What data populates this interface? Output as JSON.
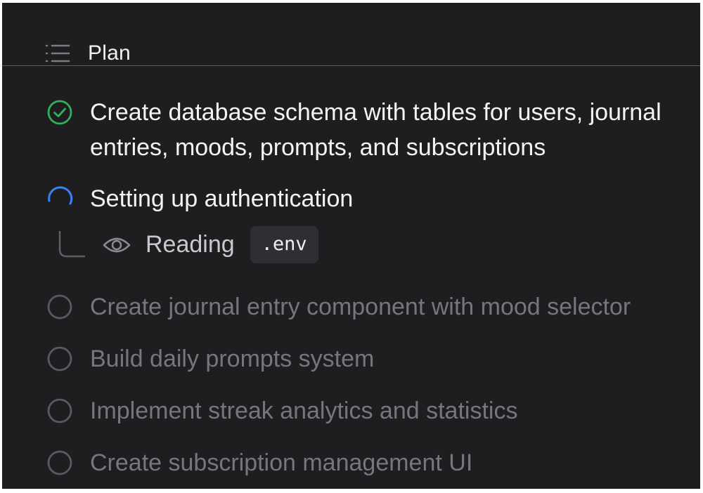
{
  "header": {
    "title": "Plan",
    "icon": "list-icon"
  },
  "tasks": [
    {
      "label": "Create database schema with tables for users, journal entries, moods, prompts, and subscriptions",
      "status": "done",
      "icon": "check-circle-icon"
    },
    {
      "label": "Setting up authentication",
      "status": "in-progress",
      "icon": "spinner-icon"
    },
    {
      "label": "Create journal entry component with mood selector",
      "status": "pending",
      "icon": "empty-circle-icon"
    },
    {
      "label": "Build daily prompts system",
      "status": "pending",
      "icon": "empty-circle-icon"
    },
    {
      "label": "Implement streak analytics and statistics",
      "status": "pending",
      "icon": "empty-circle-icon"
    },
    {
      "label": "Create subscription management UI",
      "status": "pending",
      "icon": "empty-circle-icon"
    }
  ],
  "subtask": {
    "action": "Reading",
    "file": ".env",
    "icon": "eye-icon"
  },
  "colors": {
    "background": "#1e1e20",
    "done": "#2fb25a",
    "active": "#3b82f6",
    "pending": "#5a5a60",
    "chip": "#2f2f33"
  }
}
